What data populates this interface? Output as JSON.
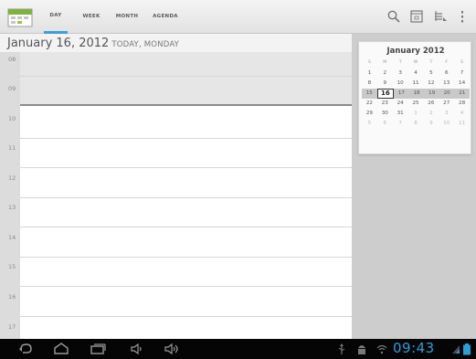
{
  "tabs": [
    {
      "label": "DAY",
      "selected": true
    },
    {
      "label": "WEEK",
      "selected": false
    },
    {
      "label": "MONTH",
      "selected": false
    },
    {
      "label": "AGENDA",
      "selected": false
    }
  ],
  "action_icons": [
    "search-icon",
    "go-to-today-icon",
    "calendars-icon",
    "overflow-menu-icon"
  ],
  "day_header": {
    "date": "January 16, 2012",
    "subtitle": "TODAY, MONDAY"
  },
  "hours": [
    "08",
    "09",
    "10",
    "11",
    "12",
    "13",
    "14",
    "15",
    "16",
    "17"
  ],
  "mini_calendar": {
    "title": "January 2012",
    "weekdays": [
      "S",
      "M",
      "T",
      "W",
      "T",
      "F",
      "S"
    ],
    "weeks": [
      {
        "days": [
          "1",
          "2",
          "3",
          "4",
          "5",
          "6",
          "7"
        ]
      },
      {
        "days": [
          "8",
          "9",
          "10",
          "11",
          "12",
          "13",
          "14"
        ]
      },
      {
        "days": [
          "15",
          "16",
          "17",
          "18",
          "19",
          "20",
          "21"
        ],
        "current": true
      },
      {
        "days": [
          "22",
          "23",
          "24",
          "25",
          "26",
          "27",
          "28"
        ]
      },
      {
        "days": [
          "29",
          "30",
          "31",
          "1",
          "2",
          "3",
          "4"
        ],
        "other_from": 3
      },
      {
        "days": [
          "5",
          "6",
          "7",
          "8",
          "9",
          "10",
          "11"
        ],
        "other_from": 0
      }
    ],
    "today": "16"
  },
  "system_bar": {
    "clock": "09:43",
    "nav_icons": [
      "back-icon",
      "home-icon",
      "recent-apps-icon",
      "volume-down-icon",
      "volume-up-icon"
    ],
    "status_icons": [
      "usb-icon",
      "android-debug-icon",
      "wifi-icon",
      "signal-icon",
      "battery-icon"
    ]
  },
  "colors": {
    "accent": "#3aa0d8",
    "clock": "#2a9fd8",
    "now_line": "#8a8a8a"
  }
}
